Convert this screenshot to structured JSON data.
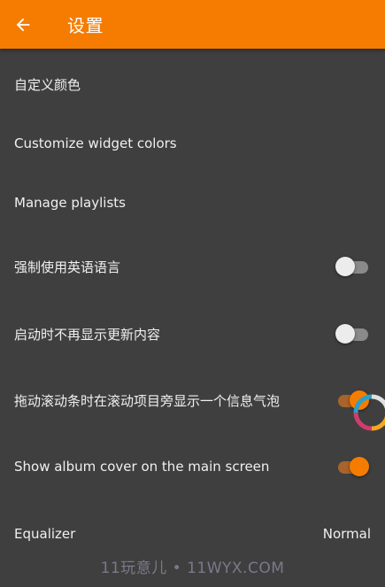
{
  "toolbar": {
    "title": "设置",
    "back_icon": "arrow-left-icon",
    "background_color": "#f57c00"
  },
  "settings": [
    {
      "label": "自定义颜色"
    },
    {
      "label": "Customize widget colors"
    },
    {
      "label": "Manage playlists"
    },
    {
      "label": "强制使用英语语言",
      "toggle": "off"
    },
    {
      "label": "启动时不再显示更新内容",
      "toggle": "off"
    },
    {
      "label": "拖动滚动条时在滚动项目旁显示一个信息气泡",
      "toggle": "on"
    },
    {
      "label": "Show album cover on the main screen",
      "toggle": "on"
    },
    {
      "label": "Equalizer",
      "value": "Normal"
    }
  ],
  "watermark": "11玩意儿 • 11WYX.COM",
  "colors": {
    "background": "#3f3f3f",
    "accent": "#f57c00",
    "text": "#f0f0f0"
  }
}
